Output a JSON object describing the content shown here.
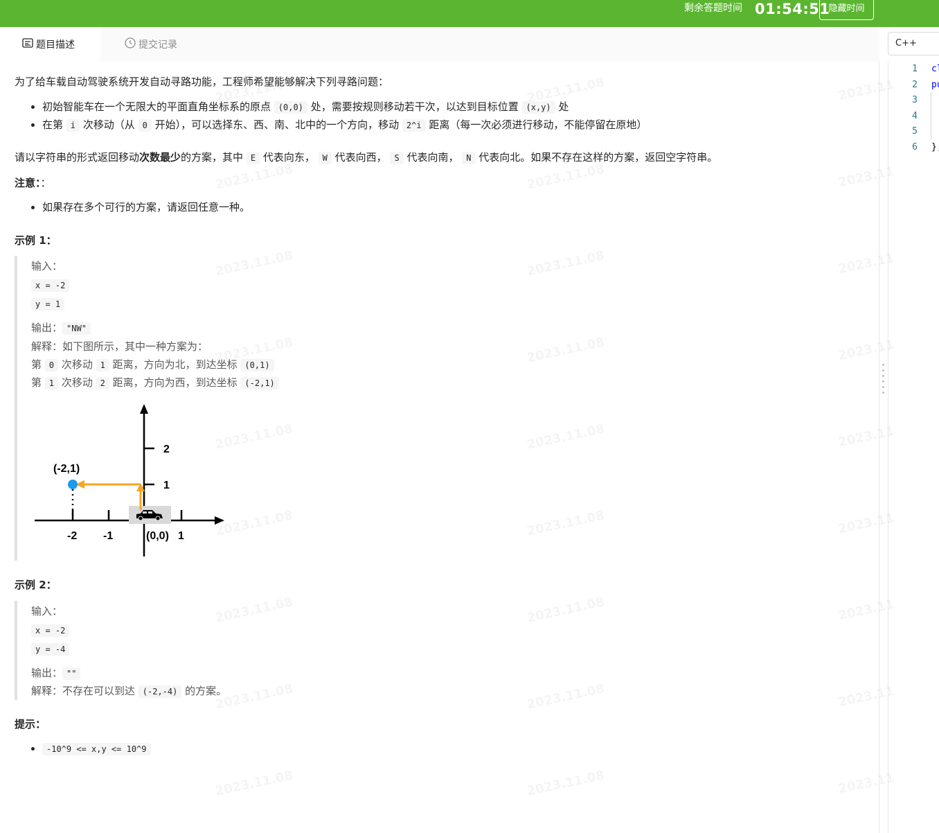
{
  "topbar": {
    "timer_label": "剩余答题时间",
    "timer_value": "01:54:51",
    "hide_button": "隐藏时间"
  },
  "tabs": {
    "description": "题目描述",
    "submissions": "提交记录"
  },
  "editor": {
    "language": "C++",
    "line_numbers": [
      "1",
      "2",
      "3",
      "4",
      "5",
      "6"
    ],
    "code_lines": [
      "cl",
      "pu",
      "",
      "",
      "",
      "};"
    ]
  },
  "problem": {
    "intro": "为了给车载自动驾驶系统开发自动寻路功能，工程师希望能够解决下列寻路问题：",
    "bullets": {
      "b1_pre": "初始智能车在一个无限大的平面直角坐标系的原点",
      "b1_code1": "(0,0)",
      "b1_mid": "处，需要按规则移动若干次，以达到目标位置",
      "b1_code2": "(x,y)",
      "b1_post": "处",
      "b2_pre": "在第",
      "b2_code1": "i",
      "b2_mid1": "次移动（从",
      "b2_code2": "0",
      "b2_mid2": "开始），可以选择东、西、南、北中的一个方向，移动",
      "b2_code3": "2^i",
      "b2_post": "距离（每一次必须进行移动，不能停留在原地）"
    },
    "task": {
      "pre": "请以字符串的形式返回移动",
      "bold": "次数最少",
      "mid1": "的方案，其中",
      "E": "E",
      "mid2": "代表向东，",
      "W": "W",
      "mid3": "代表向西，",
      "S": "S",
      "mid4": "代表向南，",
      "N": "N",
      "post": "代表向北。如果不存在这样的方案，返回空字符串。"
    },
    "note_title": "注意：",
    "note_colon": "：",
    "note_item": "如果存在多个可行的方案，请返回任意一种。",
    "example1": {
      "title": "示例 1：",
      "input_label": "输入：",
      "x": "x = -2",
      "y": "y = 1",
      "output_label": "输出：",
      "output": "\"NW\"",
      "explain": "解释：如下图所示，其中一种方案为：",
      "step1_a": "第",
      "step1_i": "0",
      "step1_b": "次移动",
      "step1_d": "1",
      "step1_c": "距离，方向为北，到达坐标",
      "step1_pos": "(0,1)",
      "step2_a": "第",
      "step2_i": "1",
      "step2_b": "次移动",
      "step2_d": "2",
      "step2_c": "距离，方向为西，到达坐标",
      "step2_pos": "(-2,1)"
    },
    "diagram": {
      "point_label": "(-2,1)",
      "x_ticks": [
        "-2",
        "-1",
        "(0,0)",
        "1"
      ],
      "y_ticks": [
        "1",
        "2"
      ],
      "colors": {
        "arrow": "#f5a623",
        "point": "#1e9be9",
        "axis": "#000000"
      }
    },
    "example2": {
      "title": "示例 2：",
      "input_label": "输入：",
      "x": "x = -2",
      "y": "y = -4",
      "output_label": "输出：",
      "output": "\"\"",
      "explain_pre": "解释：不存在可以到达",
      "explain_code": "(-2,-4)",
      "explain_post": "的方案。"
    },
    "hint_title": "提示：",
    "hint_item": "-10^9 <= x,y <= 10^9"
  }
}
